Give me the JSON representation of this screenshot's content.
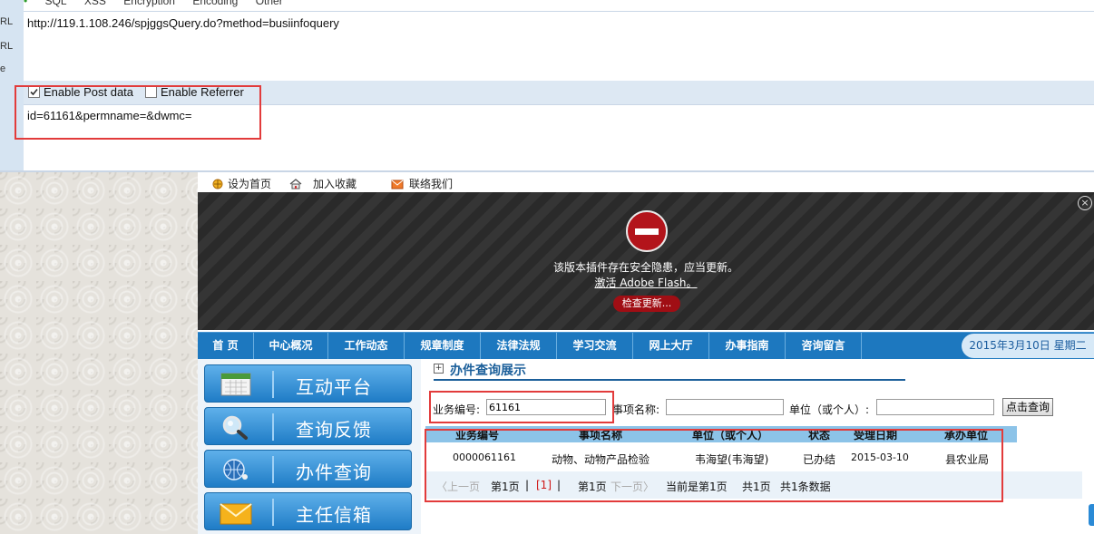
{
  "hackbar": {
    "left_labels": [
      "RL",
      "RL",
      "e"
    ],
    "menu": [
      "SQL",
      "XSS",
      "Encryption",
      "Encoding",
      "Other"
    ],
    "url": "http://119.1.108.246/spjggsQuery.do?method=busiinfoquery",
    "enable_post_label": "Enable Post data",
    "enable_post_checked": true,
    "enable_referrer_label": "Enable Referrer",
    "enable_referrer_checked": false,
    "post_data": "id=61161&permname=&dwmc="
  },
  "toplinks": {
    "home": "设为首页",
    "favorite": "加入收藏",
    "contact": "联络我们"
  },
  "flash": {
    "close": "×",
    "message": "该版本插件存在安全隐患，应当更新。",
    "activate_link": "激活 Adobe Flash。",
    "check_update": "检查更新..."
  },
  "nav": {
    "items": [
      "首 页",
      "中心概况",
      "工作动态",
      "规章制度",
      "法律法规",
      "学习交流",
      "网上大厅",
      "办事指南",
      "咨询留言"
    ],
    "date": "2015年3月10日 星期二"
  },
  "left_menu": {
    "items": [
      "互动平台",
      "查询反馈",
      "办件查询",
      "主任信箱"
    ]
  },
  "content": {
    "title": "办件查询展示",
    "query": {
      "business_no_label": "业务编号:",
      "business_no_value": "61161",
      "item_name_label": "事项名称:",
      "item_name_value": "",
      "unit_label": "单位（或个人）:",
      "unit_value": "",
      "submit": "点击查询"
    },
    "table": {
      "headers": [
        "业务编号",
        "事项名称",
        "单位（或个人）",
        "状态",
        "受理日期",
        "承办单位"
      ],
      "rows": [
        [
          "0000061161",
          "动物、动物产品检验",
          "韦海望(韦海望)",
          "已办结",
          "2015-03-10",
          "县农业局"
        ]
      ]
    },
    "pager": {
      "prev": "〈上一页",
      "first_page": "第1页",
      "sep1": "|",
      "current_link": "[1]",
      "sep2": "|",
      "last_page": "第1页",
      "next": "下一页〉",
      "current_info": "当前是第1页",
      "total_pages": "共1页",
      "total_records": "共1条数据"
    }
  },
  "colors": {
    "nav_blue": "#1d78bf",
    "annotation_red": "#e23b3b",
    "flash_button_red": "#a00e14"
  }
}
